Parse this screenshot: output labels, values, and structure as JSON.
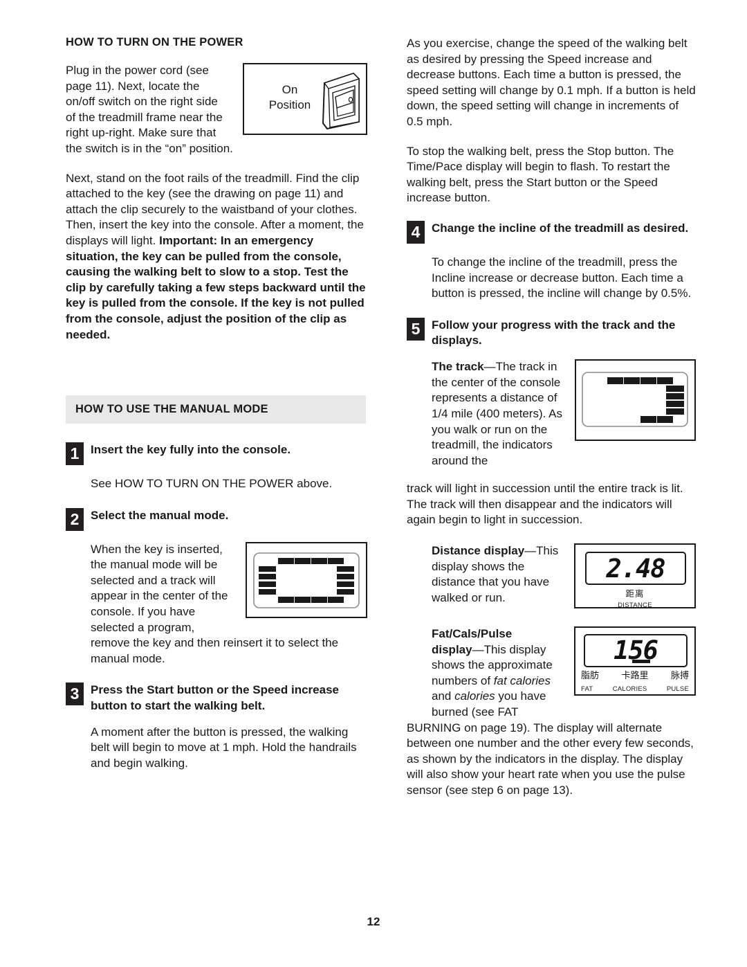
{
  "page": {
    "number": "12"
  },
  "left_column": {
    "heading_power": "HOW TO TURN ON THE POWER",
    "para_plug_in": "Plug in the power cord (see page 11). Next, locate the on/off switch on the right side of the treadmill frame near the right up-right. Make sure that the switch is in the “on” position.",
    "switch_figure": {
      "label_line1": "On",
      "label_line2": "Position",
      "icon": "rocker-switch-illustration"
    },
    "para_foot_rails_normal": "Next, stand on the foot rails of the treadmill. Find the clip attached to the key (see the drawing on page 11) and attach the clip securely to the waistband of your clothes. Then, insert the key into the console. After a moment, the displays will light. ",
    "para_foot_rails_bold": "Important: In an emergency situation, the key can be pulled from the console, causing the walking belt to slow to a stop. Test the clip by carefully taking a few steps backward until the key is pulled from the console. If the key is not pulled from the console, adjust the position of the clip as needed.",
    "heading_manual_mode": "HOW TO USE THE MANUAL MODE",
    "steps": [
      {
        "number": "1",
        "title": "Insert the key fully into the console.",
        "body": "See HOW TO TURN ON THE POWER above."
      },
      {
        "number": "2",
        "title": "Select the manual mode.",
        "body": "When the key is inserted, the manual mode will be selected and a track will appear in the center of the console. If you have selected a program, remove the key and then reinsert it to select the manual mode."
      },
      {
        "number": "3",
        "title": "Press the Start button or the Speed increase button to start the walking belt.",
        "body": "A moment after the button is pressed, the walking belt will begin to move at 1 mph. Hold the handrails and begin walking."
      }
    ]
  },
  "right_column": {
    "para_speed": "As you exercise, change the speed of the walking belt as desired by pressing the Speed increase and decrease buttons. Each time a button is pressed, the speed setting will change by 0.1 mph. If a button is held down, the speed setting will change in increments of 0.5 mph.",
    "para_stop": "To stop the walking belt, press the Stop button. The Time/Pace display will begin to flash. To restart the walking belt, press the Start button or the Speed increase button.",
    "steps": [
      {
        "number": "4",
        "title": "Change the incline of the treadmill as desired.",
        "body": "To change the incline of the treadmill, press the Incline increase or decrease button. Each time a button is pressed, the incline will change by 0.5%."
      },
      {
        "number": "5",
        "title": "Follow your progress with the track and the displays.",
        "body": ""
      }
    ],
    "track_block": {
      "label_bold": "The track",
      "text_wrapped": "—The track in the center of the console represents a distance of 1/4 mile (400 meters). As you walk or run on the treadmill, the indicators around the",
      "text_full_width": "track will light in succession until the entire track is lit. The track will then disappear and the indicators will again begin to light in succession."
    },
    "distance_block": {
      "label_bold": "Distance display",
      "text": "—This display shows the distance that you have walked or run.",
      "display": {
        "value": "2.48",
        "label_cn": "距离",
        "label_en": "DISTANCE"
      }
    },
    "fatcals_block": {
      "label_bold_line1": "Fat/Cals/Pulse",
      "label_bold_line2": "display",
      "text_part1": "—This display shows the approximate numbers of ",
      "text_italic1": "fat calories",
      "text_part2": " and ",
      "text_italic2": "calories",
      "text_part3": " you have burned (see FAT",
      "text_rest": "BURNING on page 19). The display will alternate between one number and the other every few seconds, as shown by the indicators in the display. The display will also show your heart rate when you use the pulse sensor (see step 6 on page 13).",
      "display": {
        "value": "156",
        "labels_cn": [
          "脂肪",
          "卡路里",
          "脉搏"
        ],
        "labels_en": [
          "FAT",
          "CALORIES",
          "PULSE"
        ]
      }
    }
  }
}
